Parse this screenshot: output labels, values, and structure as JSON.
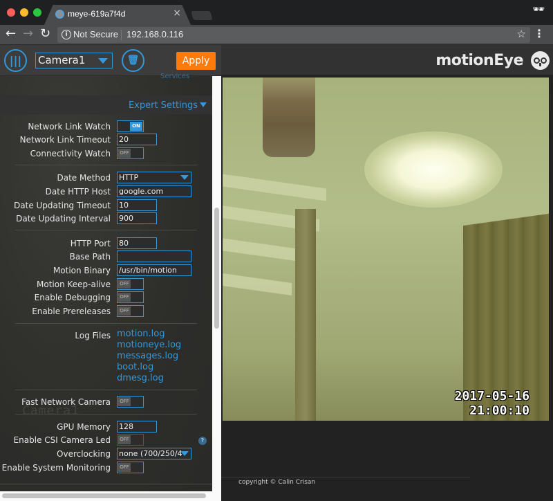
{
  "browser": {
    "tab_title": "meye-619a7f4d",
    "tab_close": "×",
    "security_label": "Not Secure",
    "url": "192.168.0.116",
    "icons": {
      "back": "←",
      "forward": "→",
      "reload": "↻",
      "info": "i",
      "star": "☆",
      "menu": "⋮",
      "incognito": "🕶"
    }
  },
  "settings": {
    "menu_icon": "|||",
    "camera_select": "Camera1",
    "delete_icon": "🗑",
    "apply_label": "Apply",
    "services_peek": "Services",
    "expert_settings_label": "Expert Settings",
    "rows": {
      "network_link_watch": {
        "label": "Network Link Watch",
        "state": "ON"
      },
      "network_link_timeout": {
        "label": "Network Link Timeout",
        "value": "20"
      },
      "connectivity_watch": {
        "label": "Connectivity Watch",
        "state": "OFF"
      },
      "date_method": {
        "label": "Date Method",
        "value": "HTTP"
      },
      "date_http_host": {
        "label": "Date HTTP Host",
        "value": "google.com"
      },
      "date_updating_timeout": {
        "label": "Date Updating Timeout",
        "value": "10"
      },
      "date_updating_interval": {
        "label": "Date Updating Interval",
        "value": "900"
      },
      "http_port": {
        "label": "HTTP Port",
        "value": "80"
      },
      "base_path": {
        "label": "Base Path",
        "value": ""
      },
      "motion_binary": {
        "label": "Motion Binary",
        "value": "/usr/bin/motion"
      },
      "motion_keepalive": {
        "label": "Motion Keep-alive",
        "state": "OFF"
      },
      "enable_debugging": {
        "label": "Enable Debugging",
        "state": "OFF"
      },
      "enable_prereleases": {
        "label": "Enable Prereleases",
        "state": "OFF"
      },
      "log_files": {
        "label": "Log Files",
        "files": [
          "motion.log",
          "motioneye.log",
          "messages.log",
          "boot.log",
          "dmesg.log"
        ]
      },
      "fast_network_camera": {
        "label": "Fast Network Camera",
        "state": "OFF"
      },
      "gpu_memory": {
        "label": "GPU Memory",
        "value": "128"
      },
      "enable_csi_camera_led": {
        "label": "Enable CSI Camera Led",
        "state": "OFF"
      },
      "overclocking": {
        "label": "Overclocking",
        "value": "none (700/250/4"
      },
      "enable_system_monitoring": {
        "label": "Enable System Monitoring",
        "state": "OFF"
      }
    },
    "help_icon": "?",
    "watermark": "Camera1"
  },
  "main": {
    "brand": "motionEye",
    "camera_timestamp_date": "2017-05-16",
    "camera_timestamp_time": "21:00:10",
    "copyright": "copyright © Calin Crisan"
  },
  "colors": {
    "accent": "#3498db",
    "apply": "#fd7a0b",
    "error_outline": "#c0282d"
  }
}
